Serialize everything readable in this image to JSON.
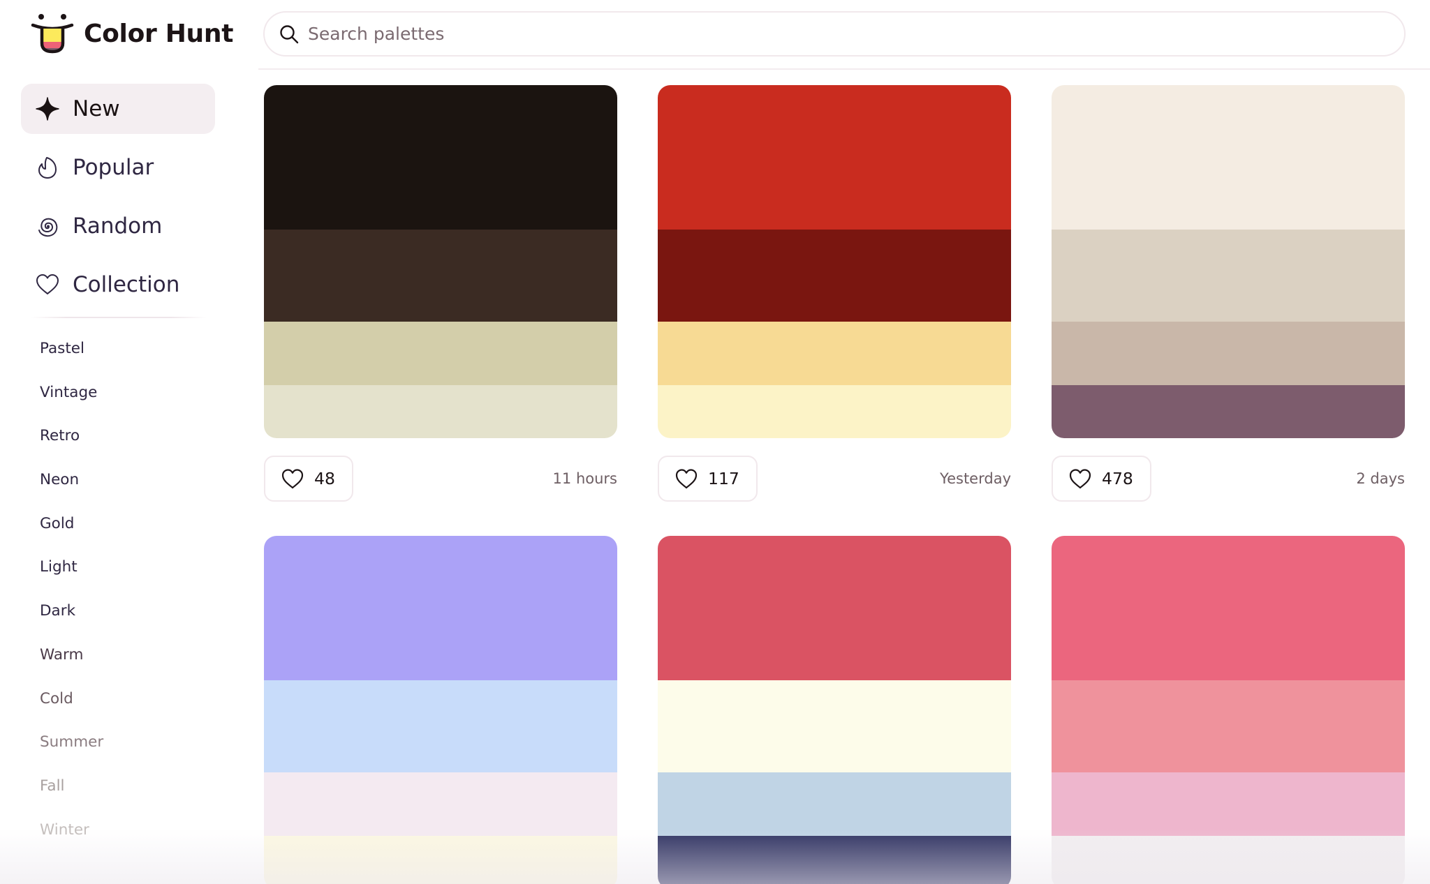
{
  "app": {
    "title": "Color Hunt",
    "logo_colors": [
      "#FCEA5C",
      "#EE6277",
      "#7B5B6B"
    ]
  },
  "search": {
    "placeholder": "Search palettes",
    "value": ""
  },
  "sidebar": {
    "main_items": [
      {
        "label": "New",
        "icon": "sparkle-icon",
        "active": true
      },
      {
        "label": "Popular",
        "icon": "flame-icon",
        "active": false
      },
      {
        "label": "Random",
        "icon": "spiral-icon",
        "active": false
      },
      {
        "label": "Collection",
        "icon": "heart-icon",
        "active": false
      }
    ],
    "tags": [
      {
        "label": "Pastel",
        "color": "#2f2742"
      },
      {
        "label": "Vintage",
        "color": "#2f2742"
      },
      {
        "label": "Retro",
        "color": "#2f2742"
      },
      {
        "label": "Neon",
        "color": "#2f2742"
      },
      {
        "label": "Gold",
        "color": "#2f2742"
      },
      {
        "label": "Light",
        "color": "#2f2742"
      },
      {
        "label": "Dark",
        "color": "#2f2742"
      },
      {
        "label": "Warm",
        "color": "#4a3a48"
      },
      {
        "label": "Cold",
        "color": "#6a5a60"
      },
      {
        "label": "Summer",
        "color": "#8a7c80"
      },
      {
        "label": "Fall",
        "color": "#a8a09f"
      },
      {
        "label": "Winter",
        "color": "#c4bebc"
      }
    ]
  },
  "palettes": [
    {
      "colors": [
        "#1B1410",
        "#3B2B23",
        "#D3CEAA",
        "#E4E2CC"
      ],
      "likes": "48",
      "time": "11 hours"
    },
    {
      "colors": [
        "#C92C1F",
        "#7A1610",
        "#F7DA94",
        "#FCF3C7"
      ],
      "likes": "117",
      "time": "Yesterday"
    },
    {
      "colors": [
        "#F4ECE2",
        "#DBD1C2",
        "#C9B7A9",
        "#7D5C6D"
      ],
      "likes": "478",
      "time": "2 days"
    },
    {
      "colors": [
        "#ABA2F7",
        "#C8DCFA",
        "#F4EAF1",
        "#FCF8E2"
      ]
    },
    {
      "colors": [
        "#DA5363",
        "#FDFCEA",
        "#C0D4E5",
        "#303362"
      ]
    },
    {
      "colors": [
        "#EB667E",
        "#EF929C",
        "#EEB6CD",
        "#F2EEF0"
      ]
    }
  ]
}
